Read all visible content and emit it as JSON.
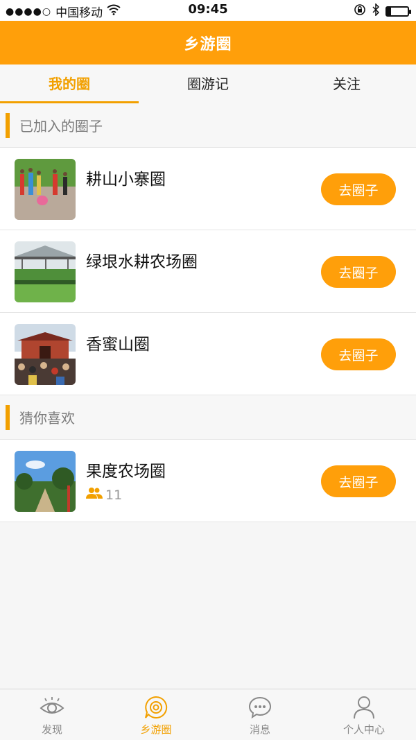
{
  "status_bar": {
    "signal_dots": "●●●●○",
    "carrier": "中国移动",
    "wifi_icon": "wifi-icon",
    "time": "09:45",
    "battery_level": 0.2
  },
  "header": {
    "title": "乡游圈"
  },
  "tabs": [
    {
      "label": "我的圈",
      "active": true
    },
    {
      "label": "圈游记",
      "active": false
    },
    {
      "label": "关注",
      "active": false
    }
  ],
  "joined_section": {
    "title": "已加入的圈子",
    "items": [
      {
        "name": "耕山小寨圈",
        "button": "去圈子",
        "image": "children-playing-in-field"
      },
      {
        "name": "绿垠水耕农场圈",
        "button": "去圈子",
        "image": "greenhouse-farm"
      },
      {
        "name": "香蜜山圈",
        "button": "去圈子",
        "image": "temple-crowd"
      }
    ]
  },
  "recommend_section": {
    "title": "猜你喜欢",
    "items": [
      {
        "name": "果度农场圈",
        "members": "11",
        "button": "去圈子",
        "image": "orchard-sky"
      }
    ]
  },
  "bottom_nav": [
    {
      "label": "发现",
      "icon": "eye-icon",
      "active": false
    },
    {
      "label": "乡游圈",
      "icon": "circle-target-icon",
      "active": true
    },
    {
      "label": "消息",
      "icon": "chat-bubble-icon",
      "active": false
    },
    {
      "label": "个人中心",
      "icon": "person-icon",
      "active": false
    }
  ],
  "colors": {
    "accent": "#ff9f0a",
    "accent_text": "#f2a000",
    "background": "#f6f6f6"
  }
}
